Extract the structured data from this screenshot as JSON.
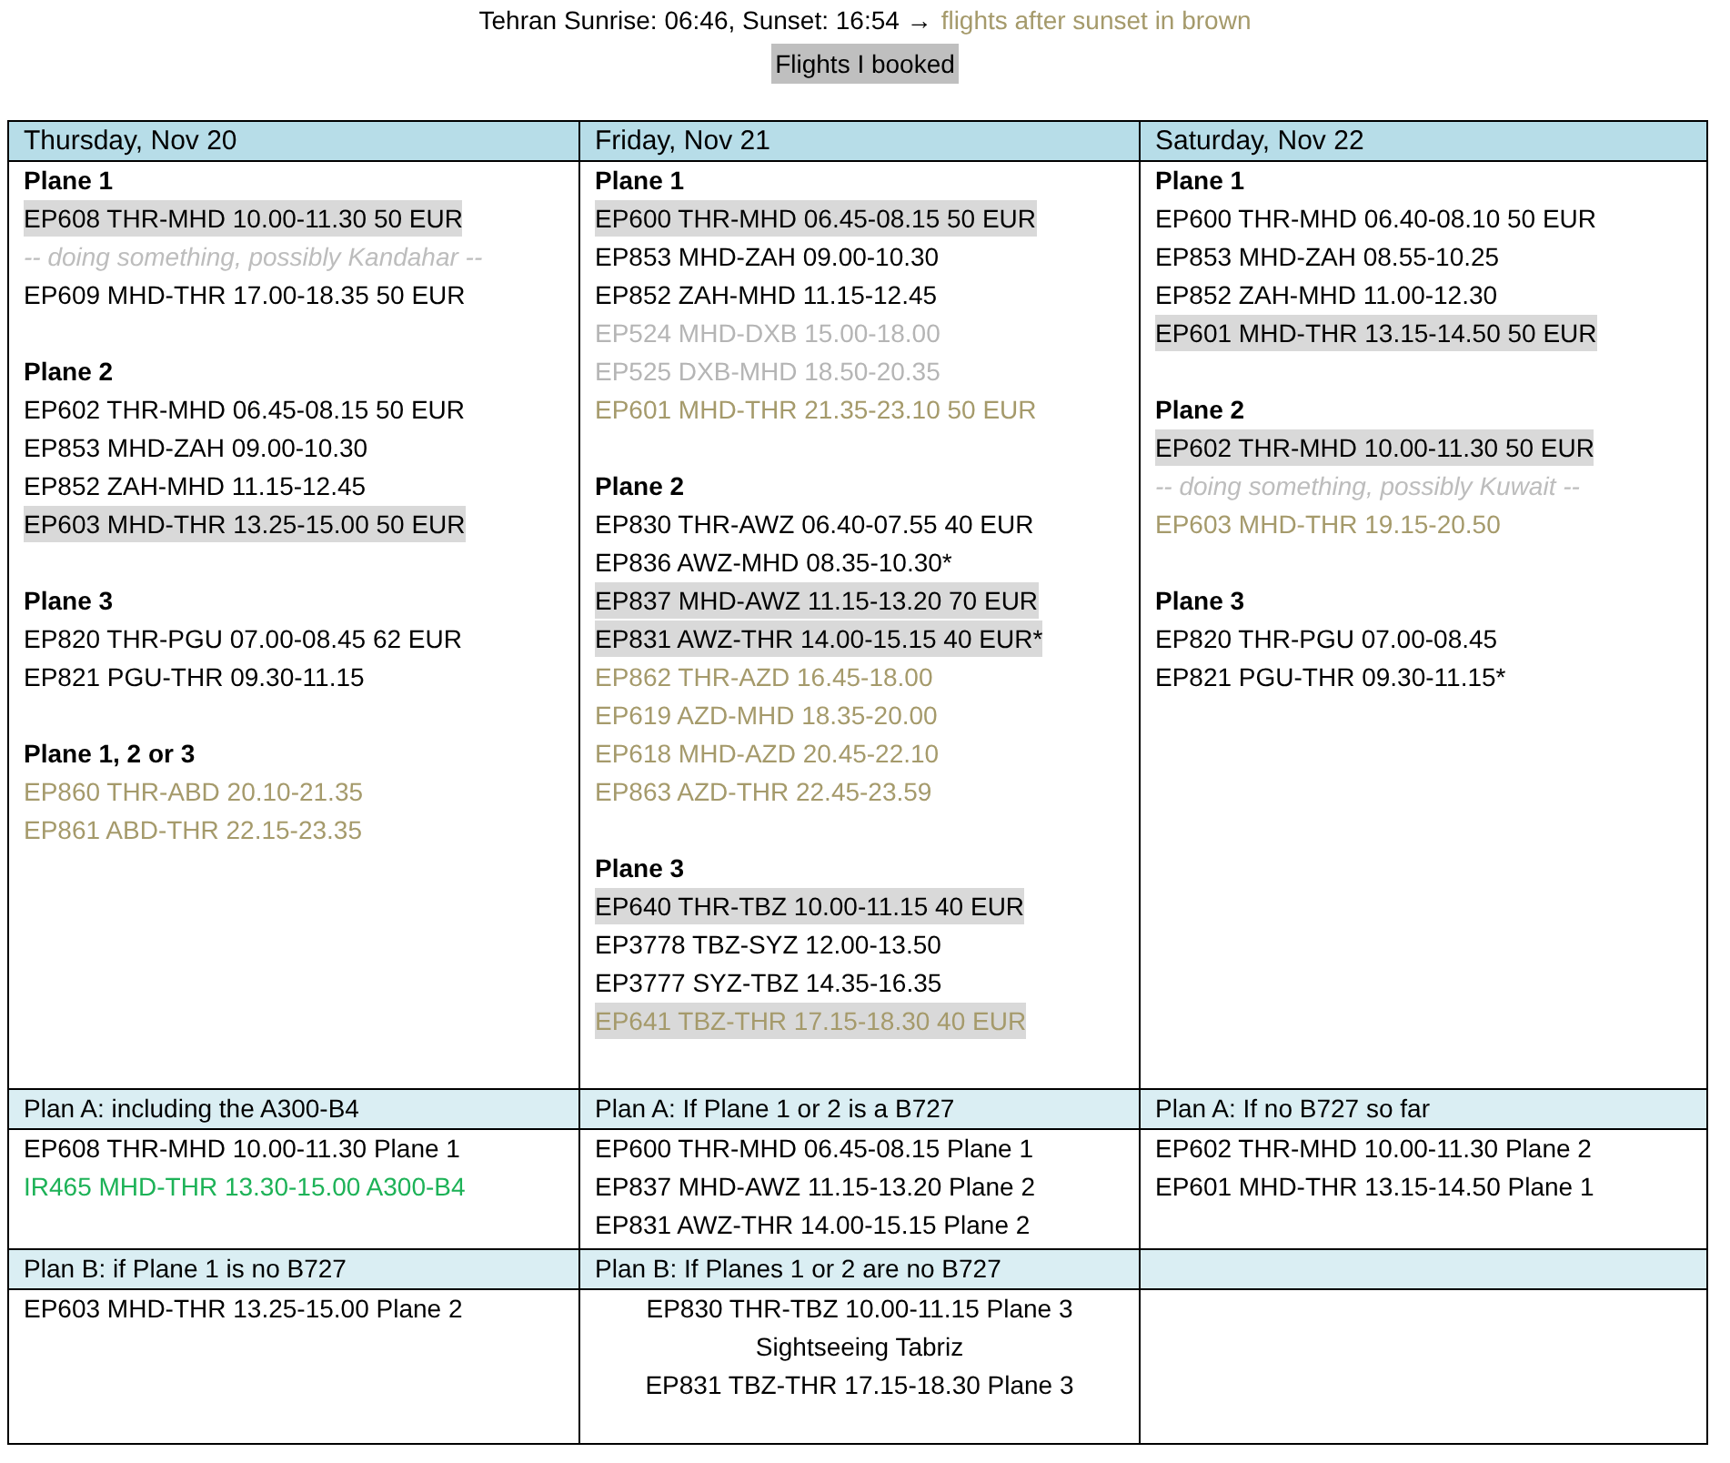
{
  "header": {
    "sun_info": "Tehran Sunrise: 06:46, Sunset: 16:54 →",
    "legend": "flights after sunset in brown",
    "booked_legend": "Flights I booked"
  },
  "days": [
    {
      "title": "Thursday, Nov 20",
      "planes": [
        {
          "title": "Plane 1",
          "lines": [
            {
              "kind": "flight",
              "text": "EP608 THR-MHD 10.00-11.30 50 EUR",
              "booked": true,
              "color": "#000000"
            },
            {
              "kind": "note",
              "text": "-- doing something, possibly Kandahar --",
              "booked": false,
              "color": "#bdbdbd"
            },
            {
              "kind": "flight",
              "text": "EP609 MHD-THR 17.00-18.35 50 EUR",
              "booked": false,
              "color": "#000000"
            }
          ]
        },
        {
          "title": "Plane 2",
          "lines": [
            {
              "kind": "flight",
              "text": "EP602 THR-MHD 06.45-08.15 50 EUR",
              "booked": false,
              "color": "#000000"
            },
            {
              "kind": "flight",
              "text": "EP853 MHD-ZAH 09.00-10.30",
              "booked": false,
              "color": "#000000"
            },
            {
              "kind": "flight",
              "text": "EP852 ZAH-MHD 11.15-12.45",
              "booked": false,
              "color": "#000000"
            },
            {
              "kind": "flight",
              "text": "EP603 MHD-THR 13.25-15.00 50 EUR",
              "booked": true,
              "color": "#000000"
            }
          ]
        },
        {
          "title": "Plane 3",
          "lines": [
            {
              "kind": "flight",
              "text": "EP820 THR-PGU 07.00-08.45 62 EUR",
              "booked": false,
              "color": "#000000"
            },
            {
              "kind": "flight",
              "text": "EP821 PGU-THR 09.30-11.15",
              "booked": false,
              "color": "#000000"
            }
          ]
        },
        {
          "title": "Plane 1, 2 or 3",
          "lines": [
            {
              "kind": "flight",
              "text": "EP860 THR-ABD 20.10-21.35",
              "booked": false,
              "color": "#a59a6b"
            },
            {
              "kind": "flight",
              "text": "EP861 ABD-THR 22.15-23.35",
              "booked": false,
              "color": "#a59a6b"
            }
          ]
        }
      ]
    },
    {
      "title": "Friday, Nov 21",
      "planes": [
        {
          "title": "Plane 1",
          "lines": [
            {
              "kind": "flight",
              "text": "EP600 THR-MHD 06.45-08.15 50 EUR",
              "booked": true,
              "color": "#000000"
            },
            {
              "kind": "flight",
              "text": "EP853 MHD-ZAH 09.00-10.30",
              "booked": false,
              "color": "#000000"
            },
            {
              "kind": "flight",
              "text": "EP852 ZAH-MHD 11.15-12.45",
              "booked": false,
              "color": "#000000"
            },
            {
              "kind": "flight",
              "text": "EP524 MHD-DXB 15.00-18.00",
              "booked": false,
              "color": "#b5b5b5"
            },
            {
              "kind": "flight",
              "text": "EP525 DXB-MHD 18.50-20.35",
              "booked": false,
              "color": "#b5b5b5"
            },
            {
              "kind": "flight",
              "text": "EP601 MHD-THR 21.35-23.10 50 EUR",
              "booked": false,
              "color": "#a59a6b"
            }
          ]
        },
        {
          "title": "Plane 2",
          "lines": [
            {
              "kind": "flight",
              "text": "EP830 THR-AWZ 06.40-07.55 40 EUR",
              "booked": false,
              "color": "#000000"
            },
            {
              "kind": "flight",
              "text": "EP836 AWZ-MHD 08.35-10.30*",
              "booked": false,
              "color": "#000000"
            },
            {
              "kind": "flight",
              "text": "EP837 MHD-AWZ 11.15-13.20 70 EUR",
              "booked": true,
              "color": "#000000"
            },
            {
              "kind": "flight",
              "text": "EP831 AWZ-THR 14.00-15.15 40 EUR*",
              "booked": true,
              "color": "#000000"
            },
            {
              "kind": "flight",
              "text": "EP862 THR-AZD 16.45-18.00",
              "booked": false,
              "color": "#a59a6b"
            },
            {
              "kind": "flight",
              "text": "EP619 AZD-MHD 18.35-20.00",
              "booked": false,
              "color": "#a59a6b"
            },
            {
              "kind": "flight",
              "text": "EP618 MHD-AZD 20.45-22.10",
              "booked": false,
              "color": "#a59a6b"
            },
            {
              "kind": "flight",
              "text": "EP863 AZD-THR 22.45-23.59",
              "booked": false,
              "color": "#a59a6b"
            }
          ]
        },
        {
          "title": "Plane 3",
          "lines": [
            {
              "kind": "flight",
              "text": "EP640 THR-TBZ 10.00-11.15 40 EUR",
              "booked": true,
              "color": "#000000"
            },
            {
              "kind": "flight",
              "text": "EP3778 TBZ-SYZ 12.00-13.50",
              "booked": false,
              "color": "#000000"
            },
            {
              "kind": "flight",
              "text": "EP3777 SYZ-TBZ 14.35-16.35",
              "booked": false,
              "color": "#000000"
            },
            {
              "kind": "flight",
              "text": "EP641 TBZ-THR 17.15-18.30 40 EUR",
              "booked": true,
              "color": "#a59a6b"
            }
          ]
        }
      ]
    },
    {
      "title": "Saturday, Nov 22",
      "planes": [
        {
          "title": "Plane 1",
          "lines": [
            {
              "kind": "flight",
              "text": "EP600 THR-MHD 06.40-08.10 50 EUR",
              "booked": false,
              "color": "#000000"
            },
            {
              "kind": "flight",
              "text": "EP853 MHD-ZAH 08.55-10.25",
              "booked": false,
              "color": "#000000"
            },
            {
              "kind": "flight",
              "text": "EP852 ZAH-MHD 11.00-12.30",
              "booked": false,
              "color": "#000000"
            },
            {
              "kind": "flight",
              "text": "EP601 MHD-THR 13.15-14.50 50 EUR",
              "booked": true,
              "color": "#000000"
            }
          ]
        },
        {
          "title": "Plane 2",
          "lines": [
            {
              "kind": "flight",
              "text": "EP602 THR-MHD 10.00-11.30 50 EUR",
              "booked": true,
              "color": "#000000"
            },
            {
              "kind": "note",
              "text": "-- doing something, possibly Kuwait --",
              "booked": false,
              "color": "#bdbdbd"
            },
            {
              "kind": "flight",
              "text": "EP603 MHD-THR 19.15-20.50",
              "booked": false,
              "color": "#a59a6b"
            }
          ]
        },
        {
          "title": "Plane 3",
          "lines": [
            {
              "kind": "flight",
              "text": "EP820 THR-PGU 07.00-08.45",
              "booked": false,
              "color": "#000000"
            },
            {
              "kind": "flight",
              "text": "EP821 PGU-THR 09.30-11.15*",
              "booked": false,
              "color": "#000000"
            }
          ]
        }
      ]
    }
  ],
  "plan_rows": [
    [
      {
        "title": "Plan A: including the A300-B4",
        "centered": false,
        "lines": [
          {
            "text": "EP608 THR-MHD 10.00-11.30 Plane 1",
            "color": "#000000"
          },
          {
            "text": "IR465 MHD-THR 13.30-15.00 A300-B4",
            "color": "#1db257"
          }
        ]
      },
      {
        "title": "Plan A: If Plane 1 or 2 is a B727",
        "centered": false,
        "lines": [
          {
            "text": "EP600 THR-MHD 06.45-08.15 Plane 1",
            "color": "#000000"
          },
          {
            "text": "EP837 MHD-AWZ 11.15-13.20 Plane 2",
            "color": "#000000"
          },
          {
            "text": "EP831 AWZ-THR 14.00-15.15 Plane 2",
            "color": "#000000"
          }
        ]
      },
      {
        "title": "Plan A: If no B727 so far",
        "centered": false,
        "lines": [
          {
            "text": "EP602 THR-MHD 10.00-11.30 Plane 2",
            "color": "#000000"
          },
          {
            "text": "EP601 MHD-THR 13.15-14.50 Plane 1",
            "color": "#000000"
          }
        ]
      }
    ],
    [
      {
        "title": "Plan B: if Plane 1 is no B727",
        "centered": false,
        "lines": [
          {
            "text": "EP603 MHD-THR 13.25-15.00 Plane 2",
            "color": "#000000"
          }
        ]
      },
      {
        "title": "Plan B: If Planes 1 or 2 are no B727",
        "centered": true,
        "lines": [
          {
            "text": "EP830 THR-TBZ 10.00-11.15 Plane 3",
            "color": "#000000"
          },
          {
            "text": "Sightseeing Tabriz",
            "color": "#000000"
          },
          {
            "text": "EP831 TBZ-THR 17.15-18.30 Plane 3",
            "color": "#000000"
          }
        ]
      },
      {}
    ]
  ]
}
